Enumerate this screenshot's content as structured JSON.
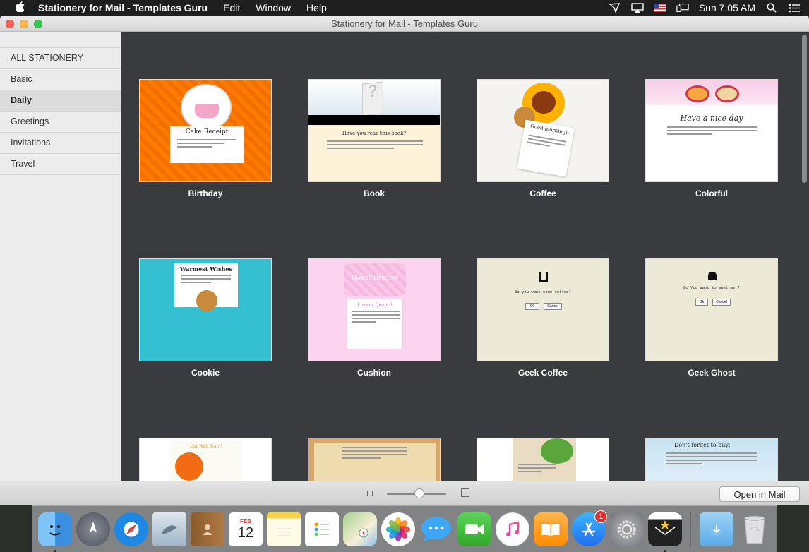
{
  "menubar": {
    "app_name": "Stationery for Mail - Templates Guru",
    "menus": [
      "Edit",
      "Window",
      "Help"
    ],
    "clock": "Sun 7:05 AM"
  },
  "window": {
    "title": "Stationery for Mail - Templates Guru"
  },
  "sidebar": {
    "items": [
      {
        "label": "ALL STATIONERY",
        "selected": false
      },
      {
        "label": "Basic",
        "selected": false
      },
      {
        "label": "Daily",
        "selected": true
      },
      {
        "label": "Greetings",
        "selected": false
      },
      {
        "label": "Invitations",
        "selected": false
      },
      {
        "label": "Travel",
        "selected": false
      }
    ]
  },
  "templates": [
    {
      "name": "Birthday",
      "heading": "Cake Receipt"
    },
    {
      "name": "Book",
      "heading": "Have you read this book?"
    },
    {
      "name": "Coffee",
      "heading": "Good morning!"
    },
    {
      "name": "Colorful",
      "heading": "Have a nice day"
    },
    {
      "name": "Cookie",
      "heading": "Warmest Wishes"
    },
    {
      "name": "Cushion",
      "heading": "Sweet Dreams",
      "subheading": "Lorem Ipsum!"
    },
    {
      "name": "Geek Coffee",
      "heading": "Do you want some coffee?",
      "ok": "Ok",
      "cancel": "Cancel"
    },
    {
      "name": "Geek Ghost",
      "heading": "Do You want to meet me ?",
      "ok": "Ok",
      "cancel": "Cancel"
    },
    {
      "name": "",
      "heading": "Get Well Soon!"
    },
    {
      "name": "",
      "heading": ""
    },
    {
      "name": "",
      "heading": ""
    },
    {
      "name": "",
      "heading": "Don't forget to buy:"
    }
  ],
  "bottombar": {
    "zoom_level": 0.55,
    "open_button": "Open in Mail"
  },
  "dock": {
    "apps": [
      "Finder",
      "Launchpad",
      "Safari",
      "Mail",
      "Contacts",
      "Calendar",
      "Notes",
      "Reminders",
      "Maps",
      "Photos",
      "Messages",
      "FaceTime",
      "iTunes",
      "iBooks",
      "App Store",
      "System Preferences",
      "Stationery",
      "Downloads",
      "Trash"
    ],
    "calendar_month": "FEB",
    "calendar_day": "12",
    "appstore_badge": "1"
  }
}
